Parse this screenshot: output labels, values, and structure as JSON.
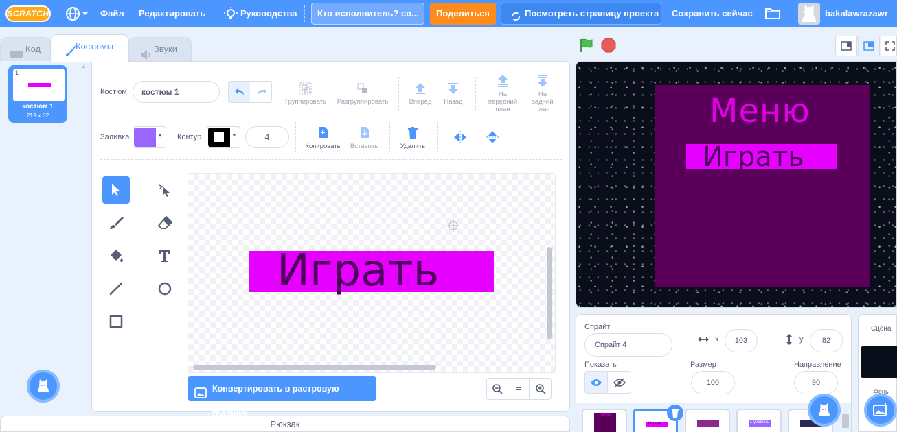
{
  "menubar": {
    "logo": "SCRATCH",
    "file": "Файл",
    "edit": "Редактировать",
    "tutorials": "Руководства",
    "project_title": "Кто исполнитель? со...",
    "share": "Поделиться",
    "see_project_page": "Посмотреть страницу проекта",
    "save_now": "Сохранить сейчас",
    "username": "bakalawrazawr"
  },
  "tabs": {
    "code": "Код",
    "costumes": "Костюмы",
    "sounds": "Звуки"
  },
  "costume_list": {
    "number": "1",
    "name": "костюм 1",
    "size": "219 x 62",
    "thumb_text": "Играть"
  },
  "paint": {
    "costume_label": "Костюм",
    "costume_name": "костюм 1",
    "group": "Группировать",
    "ungroup": "Разгруппировать",
    "forward": "Вперёд",
    "backward": "Назад",
    "front_line1": "На",
    "front_line2": "передний",
    "front_line3": "план",
    "back_line1": "На",
    "back_line2": "задний",
    "back_line3": "план",
    "fill_label": "Заливка",
    "fill_color": "#9966ff",
    "outline_label": "Контур",
    "outline_width": "4",
    "copy": "Копировать",
    "paste": "Вставить",
    "delete": "Удалить",
    "canvas_text": "Играть",
    "convert_bitmap": "Конвертировать в растровую графику",
    "zoom_reset": "="
  },
  "backpack": "Рюкзак",
  "stage": {
    "menu_title": "Меню",
    "play_text": "Играть"
  },
  "sprite_info": {
    "sprite_label": "Спрайт",
    "sprite_name": "Спрайт 4",
    "x_label": "x",
    "x": "103",
    "y_label": "y",
    "y": "82",
    "show_label": "Показать",
    "size_label": "Размер",
    "size": "100",
    "direction_label": "Направление",
    "direction": "90"
  },
  "sprite_tiles": [
    {
      "text": "Меню"
    },
    {
      "text": "Играть"
    },
    {
      "text": ""
    },
    {
      "text": "1 уровень"
    },
    {
      "text": ""
    }
  ],
  "stage_pane": {
    "label": "Сцена",
    "backdrops": "Фоны"
  },
  "colors": {
    "accent": "#4c97ff",
    "share": "#ff8c1a",
    "magenta": "#e600ff",
    "dark_purple": "#5a005a"
  }
}
